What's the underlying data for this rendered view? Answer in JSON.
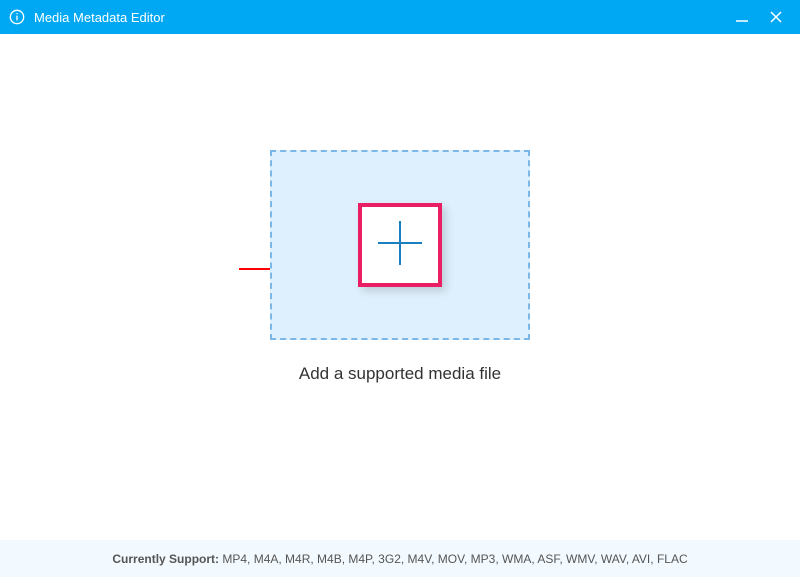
{
  "titlebar": {
    "title": "Media Metadata Editor"
  },
  "dropzone": {
    "label": "Add a supported media file"
  },
  "footer": {
    "label": "Currently Support: ",
    "formats": "MP4, M4A, M4R, M4B, M4P, 3G2, M4V, MOV, MP3, WMA, ASF, WMV, WAV, AVI, FLAC"
  }
}
